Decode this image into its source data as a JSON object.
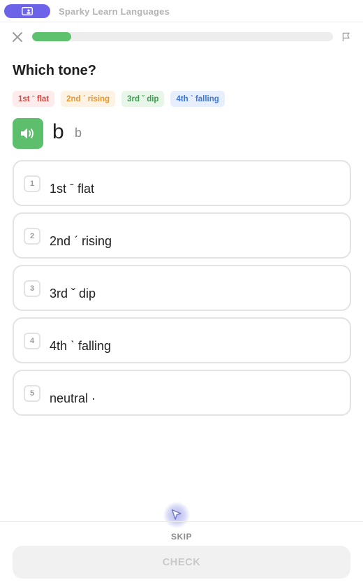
{
  "app": {
    "title": "Sparky Learn Languages",
    "brand_color": "#6c63e8"
  },
  "progress": {
    "percent": 13,
    "color": "#5dc16d"
  },
  "lesson": {
    "question": "Which tone?",
    "chips": [
      {
        "label": "1st ˉ flat",
        "text_color": "#d8463f",
        "bg": "#fdeceb"
      },
      {
        "label": "2nd ˊ rising",
        "text_color": "#e8962c",
        "bg": "#fdf3e4"
      },
      {
        "label": "3rd ˇ dip",
        "text_color": "#3c9e4e",
        "bg": "#e8f6ea"
      },
      {
        "label": "4th ˋ falling",
        "text_color": "#3e76d8",
        "bg": "#e8effc"
      }
    ],
    "character": "b",
    "pronunciation": "b",
    "audio_icon": "speaker-icon",
    "options": [
      {
        "number": "1",
        "label": "1st ˉ flat"
      },
      {
        "number": "2",
        "label": "2nd ˊ rising"
      },
      {
        "number": "3",
        "label": "3rd ˇ dip"
      },
      {
        "number": "4",
        "label": "4th ˋ falling"
      },
      {
        "number": "5",
        "label": "neutral ·"
      }
    ]
  },
  "footer": {
    "skip_label": "SKIP",
    "check_label": "CHECK"
  }
}
